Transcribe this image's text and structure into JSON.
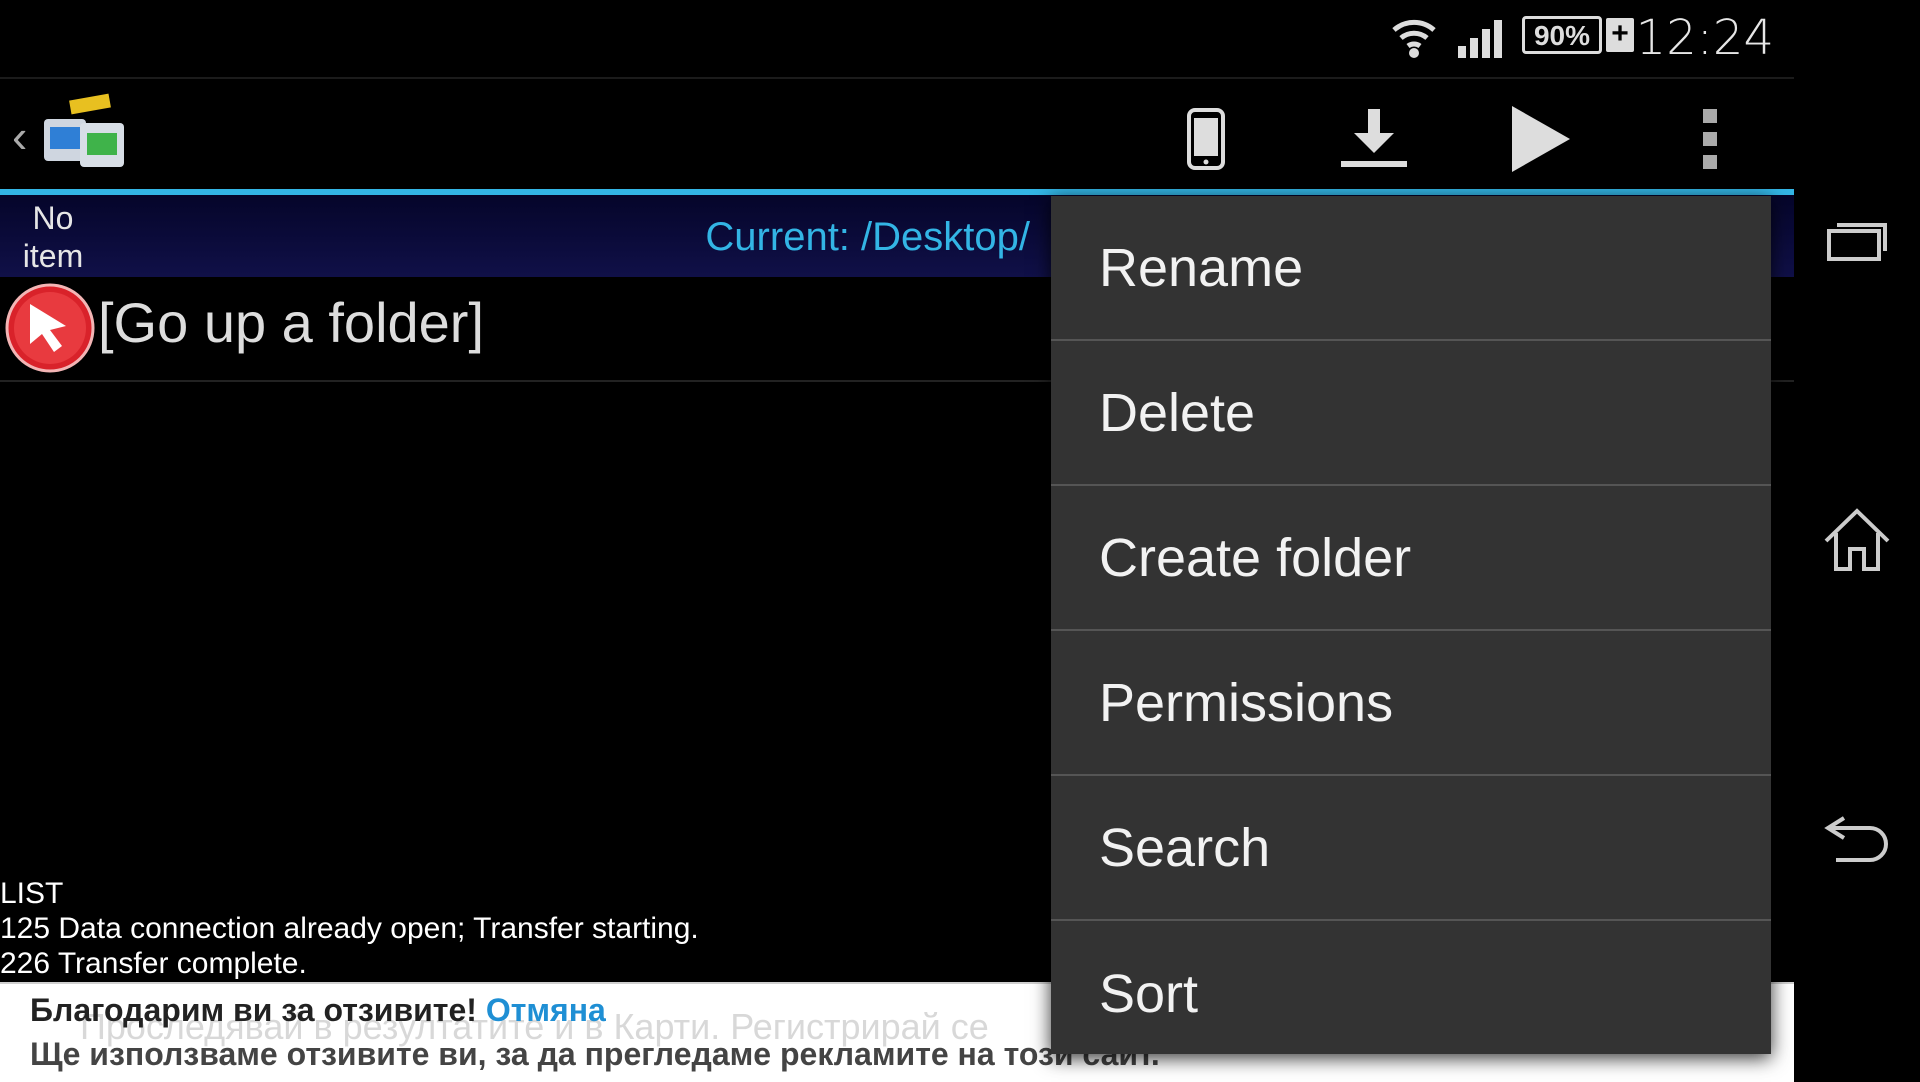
{
  "status_bar": {
    "battery_percent": "90%",
    "charging_symbol": "+",
    "time": "12:24",
    "icons": [
      "wifi-icon",
      "signal-icon",
      "battery-icon"
    ]
  },
  "action_bar": {
    "back_symbol": "‹",
    "app_icon": "ftp-server-icon",
    "actions": [
      "phone-icon",
      "download-icon",
      "play-icon",
      "overflow-menu-icon"
    ]
  },
  "path_bar": {
    "no_item": "No item",
    "current_path": "Current: /Desktop/"
  },
  "list": {
    "up_folder_label": "[Go up a folder]"
  },
  "log": [
    "LIST",
    "125 Data connection already open; Transfer starting.",
    "226 Transfer complete."
  ],
  "banner": {
    "ghost_text": "Проследявай в резултатите и в Карти. Регистрирай се",
    "thanks": "Благодарим ви за отзивите!",
    "cancel": "Отмяна",
    "message": "Ще използваме отзивите ви, за да прегледаме рекламите на този сайт."
  },
  "menu": {
    "items": [
      "Rename",
      "Delete",
      "Create folder",
      "Permissions",
      "Search",
      "Sort"
    ]
  },
  "nav_bar": [
    "recent-apps-icon",
    "home-icon",
    "back-icon"
  ],
  "colors": {
    "accent": "#33b5e5",
    "menu_bg": "#333333",
    "path_bar_bg": "#0b0b3a"
  }
}
